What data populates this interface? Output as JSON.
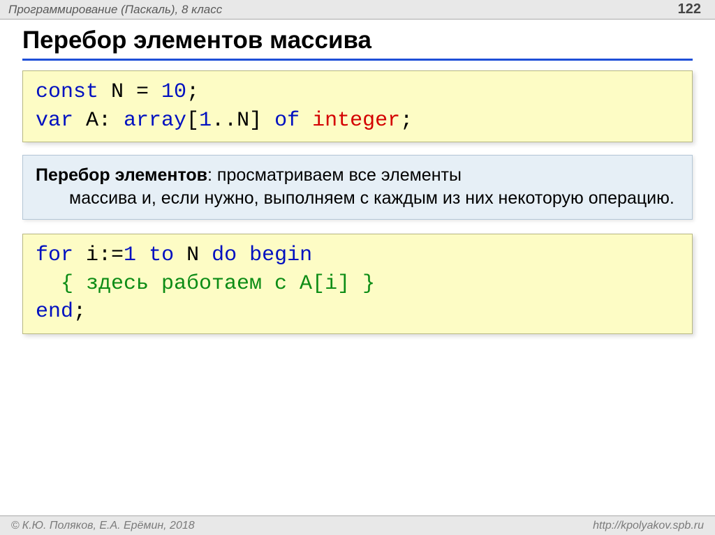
{
  "header": {
    "course": "Программирование (Паскаль), 8 класс",
    "page": "122"
  },
  "title": "Перебор элементов массива",
  "code1": {
    "l1_a": "const",
    "l1_b": " N",
    "l1_eq": " = ",
    "l1_n": "10",
    "l1_c": ";",
    "l2_a": "var",
    "l2_b": " A: ",
    "l2_arr": "array",
    "l2_c": "[",
    "l2_d": "1",
    "l2_e": "..N] ",
    "l2_of": "of",
    "l2_sp": " ",
    "l2_int": "integer",
    "l2_f": ";"
  },
  "definition": {
    "bold": "Перебор элементов",
    "rest1": ": просматриваем все элементы",
    "rest2": "массива и, если нужно, выполняем с каждым из них некоторую операцию."
  },
  "code2": {
    "l1_a": "for",
    "l1_b": " i:=",
    "l1_n": "1",
    "l1_c": " ",
    "l1_to": "to",
    "l1_d": " N ",
    "l1_do": "do",
    "l1_e": " ",
    "l1_begin": "begin",
    "l2_cmt": "  { здесь работаем с A[i] }",
    "l3_end": "end",
    "l3_s": ";"
  },
  "footer": {
    "copyright": "К.Ю. Поляков, Е.А. Ерёмин, 2018",
    "url": "http://kpolyakov.spb.ru"
  }
}
